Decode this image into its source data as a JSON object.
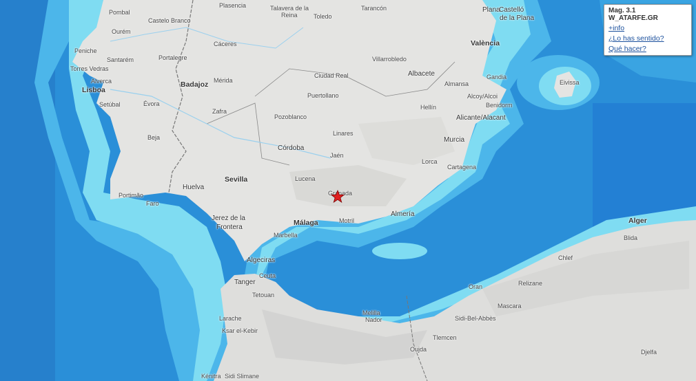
{
  "popup": {
    "title": "Mag. 3.1 W_ATARFE.GR",
    "links": [
      "+info",
      "¿Lo has sentido?",
      "Qué hacer?"
    ]
  },
  "epicenter": {
    "icon": "star-icon",
    "color": "#e02020"
  },
  "colors": {
    "land": "#e4e4e2",
    "shelf": "#7fdcf2",
    "slope": "#4cc0ec",
    "deep": "#2a8fd8"
  },
  "places": [
    {
      "name": "Pombal"
    },
    {
      "name": "Castelo Branco"
    },
    {
      "name": "Plasencia"
    },
    {
      "name": "Talavera de la"
    },
    {
      "name": "Reina"
    },
    {
      "name": "Toledo"
    },
    {
      "name": "Tarancón"
    },
    {
      "name": "Plana"
    },
    {
      "name": "Castelló"
    },
    {
      "name": "de la Plana"
    },
    {
      "name": "Ourém"
    },
    {
      "name": "Cáceres"
    },
    {
      "name": "Peniche"
    },
    {
      "name": "Santarém"
    },
    {
      "name": "Portalegre"
    },
    {
      "name": "Torres Vedras"
    },
    {
      "name": "Alverca"
    },
    {
      "name": "Lisboa"
    },
    {
      "name": "Setúbal"
    },
    {
      "name": "Badajoz"
    },
    {
      "name": "Mérida"
    },
    {
      "name": "Évora"
    },
    {
      "name": "Ciudad Real"
    },
    {
      "name": "Villarrobledo"
    },
    {
      "name": "Albacete"
    },
    {
      "name": "València"
    },
    {
      "name": "Gandia"
    },
    {
      "name": "Almansa"
    },
    {
      "name": "Alcoy/Alcoi"
    },
    {
      "name": "Benidorm"
    },
    {
      "name": "Puertollano"
    },
    {
      "name": "Zafra"
    },
    {
      "name": "Pozoblanco"
    },
    {
      "name": "Hellín"
    },
    {
      "name": "Alicante/Alacant"
    },
    {
      "name": "Eivissa"
    },
    {
      "name": "Linares"
    },
    {
      "name": "Beja"
    },
    {
      "name": "Córdoba"
    },
    {
      "name": "Murcia"
    },
    {
      "name": "Jaén"
    },
    {
      "name": "Lorca"
    },
    {
      "name": "Cartagena"
    },
    {
      "name": "Huelva"
    },
    {
      "name": "Sevilla"
    },
    {
      "name": "Lucena"
    },
    {
      "name": "Portimão"
    },
    {
      "name": "Faro"
    },
    {
      "name": "Granada"
    },
    {
      "name": "Almería"
    },
    {
      "name": "Jerez de la"
    },
    {
      "name": "Frontera"
    },
    {
      "name": "Málaga"
    },
    {
      "name": "Motril"
    },
    {
      "name": "Marbella"
    },
    {
      "name": "Algeciras"
    },
    {
      "name": "Ceuta"
    },
    {
      "name": "Tanger"
    },
    {
      "name": "Tetouan"
    },
    {
      "name": "Alger"
    },
    {
      "name": "Blida"
    },
    {
      "name": "Chlef"
    },
    {
      "name": "Oran"
    },
    {
      "name": "Relizane"
    },
    {
      "name": "Mascara"
    },
    {
      "name": "Sidi-Bel-Abbès"
    },
    {
      "name": "Tlemcen"
    },
    {
      "name": "Larache"
    },
    {
      "name": "Ksar el-Kebir"
    },
    {
      "name": "Melilla"
    },
    {
      "name": "Nador"
    },
    {
      "name": "Oujda"
    },
    {
      "name": "Djelfa"
    },
    {
      "name": "Kénitra"
    },
    {
      "name": "Sidi Slimane"
    }
  ]
}
